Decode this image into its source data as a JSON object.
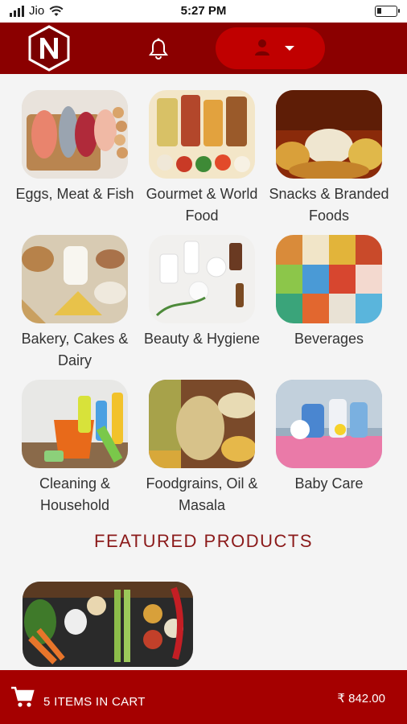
{
  "status_bar": {
    "carrier": "Jio",
    "time": "5:27 PM"
  },
  "header": {
    "logo_alt": "N",
    "icons": [
      "bell-icon",
      "user-icon",
      "caret-down-icon"
    ]
  },
  "categories": [
    {
      "label": "Eggs, Meat & Fish",
      "image": "eggs-meat-fish"
    },
    {
      "label": "Gourmet & World Food",
      "image": "gourmet-world-food"
    },
    {
      "label": "Snacks & Branded Foods",
      "image": "snacks-branded-foods"
    },
    {
      "label": "Bakery, Cakes & Dairy",
      "image": "bakery-cakes-dairy"
    },
    {
      "label": "Beauty & Hygiene",
      "image": "beauty-hygiene"
    },
    {
      "label": "Beverages",
      "image": "beverages"
    },
    {
      "label": "Cleaning & Household",
      "image": "cleaning-household"
    },
    {
      "label": "Foodgrains, Oil & Masala",
      "image": "foodgrains-oil-masala"
    },
    {
      "label": "Baby Care",
      "image": "baby-care"
    }
  ],
  "featured": {
    "title": "FEATURED PRODUCTS"
  },
  "cart": {
    "count_text": "5 ITEMS IN CART",
    "total": "₹ 842.00"
  },
  "colors": {
    "header": "#8b0000",
    "account_pill": "#c00000",
    "cart_bar": "#a50000",
    "featured_title": "#8b1a1a"
  }
}
